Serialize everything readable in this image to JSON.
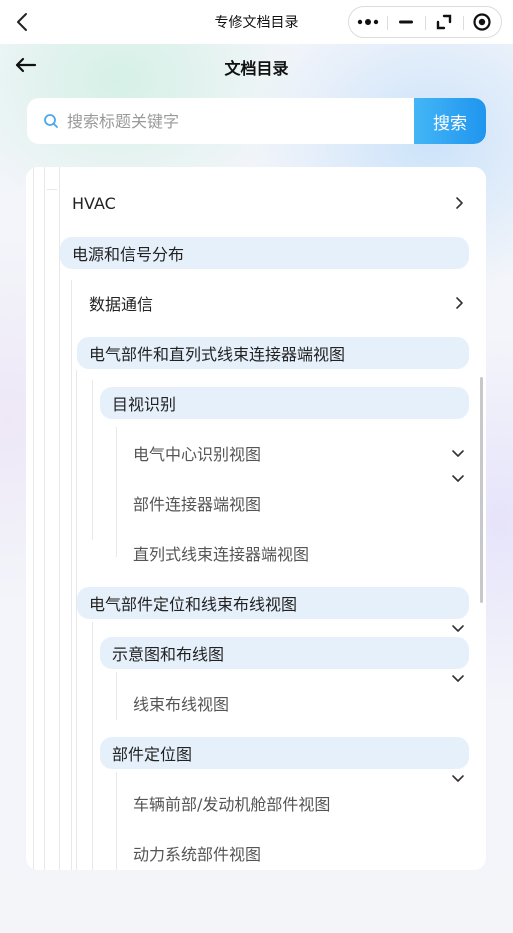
{
  "topbar": {
    "title": "专修文档目录"
  },
  "header": {
    "title": "文档目录"
  },
  "search": {
    "placeholder": "搜索标题关键字",
    "button_label": "搜索"
  },
  "tree": {
    "hvac": "HVAC",
    "power_signal": "电源和信号分布",
    "data_comm": "数据通信",
    "connector_views": "电气部件和直列式线束连接器端视图",
    "visual_id": "目视识别",
    "center_id_views": "电气中心识别视图",
    "component_connector_views": "部件连接器端视图",
    "inline_connector_views": "直列式线束连接器端视图",
    "component_location": "电气部件定位和线束布线视图",
    "schematics_routing": "示意图和布线图",
    "harness_routing": "线束布线视图",
    "component_locator": "部件定位图",
    "front_engine_views": "车辆前部/发动机舱部件视图",
    "powertrain_views": "动力系统部件视图"
  },
  "colors": {
    "accent": "#1f95ee",
    "highlight": "#e6f0fb"
  }
}
